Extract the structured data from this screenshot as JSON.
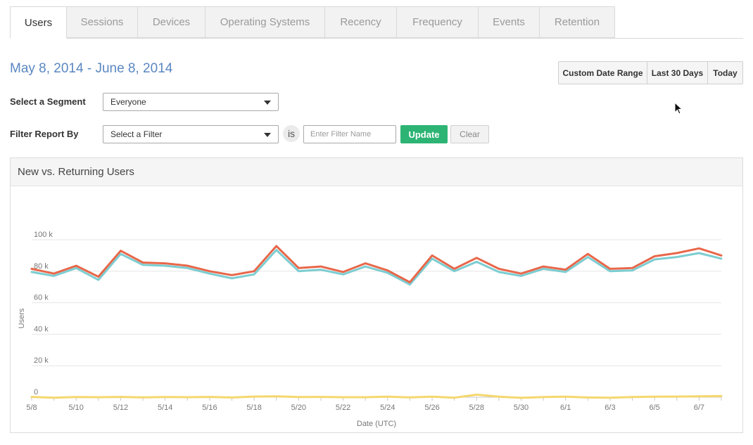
{
  "tabs": [
    {
      "label": "Users",
      "active": true
    },
    {
      "label": "Sessions",
      "active": false
    },
    {
      "label": "Devices",
      "active": false
    },
    {
      "label": "Operating Systems",
      "active": false
    },
    {
      "label": "Recency",
      "active": false
    },
    {
      "label": "Frequency",
      "active": false
    },
    {
      "label": "Events",
      "active": false
    },
    {
      "label": "Retention",
      "active": false
    }
  ],
  "date_range": "May 8, 2014 - June 8, 2014",
  "range_buttons": {
    "custom": "Custom Date Range",
    "last30": "Last 30 Days",
    "today": "Today"
  },
  "segment": {
    "label": "Select a Segment",
    "value": "Everyone"
  },
  "filter": {
    "label": "Filter Report By",
    "select_value": "Select a Filter",
    "is_label": "is",
    "name_placeholder": "Enter Filter Name",
    "update_label": "Update",
    "clear_label": "Clear"
  },
  "panel": {
    "title": "New vs. Returning Users"
  },
  "colors": {
    "accent_green": "#2db474",
    "date_blue": "#5a87c2"
  },
  "chart_data": {
    "type": "line",
    "xlabel": "Date (UTC)",
    "ylabel": "Users",
    "ylim": [
      0,
      100000
    ],
    "y_ticks": [
      0,
      20000,
      40000,
      60000,
      80000,
      100000
    ],
    "y_tick_labels": [
      "0",
      "20 k",
      "40 k",
      "60 k",
      "80 k",
      "100 k"
    ],
    "x_tick_labels": [
      "5/8",
      "5/10",
      "5/12",
      "5/14",
      "5/16",
      "5/18",
      "5/20",
      "5/22",
      "5/24",
      "5/26",
      "5/28",
      "5/30",
      "6/1",
      "6/3",
      "6/5",
      "6/7"
    ],
    "x": [
      "5/8",
      "5/9",
      "5/10",
      "5/11",
      "5/12",
      "5/13",
      "5/14",
      "5/15",
      "5/16",
      "5/17",
      "5/18",
      "5/19",
      "5/20",
      "5/21",
      "5/22",
      "5/23",
      "5/24",
      "5/25",
      "5/26",
      "5/27",
      "5/28",
      "5/29",
      "5/30",
      "5/31",
      "6/1",
      "6/2",
      "6/3",
      "6/4",
      "6/5",
      "6/6",
      "6/7",
      "6/8"
    ],
    "grid": true,
    "series": [
      {
        "color": "#e8674a",
        "values": [
          81500,
          78500,
          83500,
          76500,
          93000,
          85500,
          85000,
          83500,
          80000,
          77500,
          80000,
          96000,
          82000,
          83000,
          79500,
          85000,
          80500,
          73000,
          90000,
          81500,
          88500,
          81500,
          78500,
          83000,
          81000,
          91000,
          81500,
          82000,
          89500,
          91500,
          94500,
          90000
        ]
      },
      {
        "color": "#7ccdd1",
        "values": [
          79500,
          77000,
          82000,
          74500,
          91000,
          84000,
          83500,
          82000,
          78500,
          75500,
          78000,
          93500,
          80000,
          81000,
          78000,
          83000,
          79000,
          71500,
          88000,
          80000,
          86000,
          79500,
          77000,
          81500,
          79500,
          89000,
          80000,
          80500,
          87500,
          89000,
          91500,
          88000
        ]
      },
      {
        "color": "#f5d76e",
        "values": [
          200,
          -300,
          100,
          0,
          200,
          -100,
          100,
          0,
          200,
          -200,
          400,
          600,
          100,
          200,
          0,
          0,
          300,
          -100,
          300,
          -300,
          1600,
          300,
          -400,
          100,
          300,
          -200,
          -300,
          100,
          300,
          400,
          600,
          700
        ]
      }
    ]
  }
}
